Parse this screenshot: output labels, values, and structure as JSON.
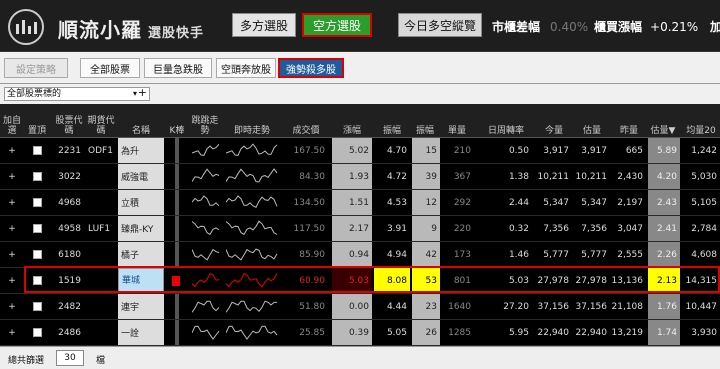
{
  "header": {
    "brand": "順流小羅",
    "subtitle": "選股快手",
    "buttons": [
      {
        "label": "多方選股",
        "active": false
      },
      {
        "label": "空方選股",
        "active": true
      }
    ],
    "overview_button": "今日多空縱覽",
    "metrics": [
      {
        "label": "市櫃差幅",
        "value": "0.40%",
        "dim": true
      },
      {
        "label": "櫃買漲幅",
        "value": "+0.21%",
        "dim": false
      }
    ],
    "metric_cut": "加"
  },
  "strategy_bar": {
    "set_strategy": "設定策略",
    "tabs": [
      {
        "label": "全部股票",
        "active": false
      },
      {
        "label": "巨量急跌股",
        "active": false
      },
      {
        "label": "空頭奔放股",
        "active": false
      },
      {
        "label": "強勢殺多股",
        "active": true
      }
    ]
  },
  "filter": {
    "selected": "全部股票標的",
    "arrow": "▾",
    "plus": "+"
  },
  "table": {
    "columns": [
      "加自選",
      "置頂",
      "股票代碼",
      "期貨代碼",
      "名稱",
      "K棒",
      "跳跳走勢",
      "即時走勢",
      "成交價",
      "漲幅",
      "振幅",
      "振幅",
      "單量",
      "日周轉率",
      "今量",
      "估量",
      "昨量",
      "估量▼",
      "均量20"
    ],
    "rows": [
      {
        "add": "+",
        "code": "2231",
        "fut": "ODF1",
        "name": "為升",
        "price": "167.50",
        "chg": "5.02",
        "amp": "4.70",
        "amp2": "15",
        "vol": "210",
        "turn": "0.50",
        "today": "3,917",
        "est": "3,917",
        "yest": "665",
        "ratio": "5.89",
        "avg": "1,242"
      },
      {
        "add": "+",
        "code": "3022",
        "fut": "",
        "name": "威強電",
        "price": "84.30",
        "chg": "1.93",
        "amp": "4.72",
        "amp2": "39",
        "vol": "367",
        "turn": "1.38",
        "today": "10,211",
        "est": "10,211",
        "yest": "2,430",
        "ratio": "4.20",
        "avg": "5,030"
      },
      {
        "add": "+",
        "code": "4968",
        "fut": "",
        "name": "立積",
        "price": "134.50",
        "chg": "1.51",
        "amp": "4.53",
        "amp2": "12",
        "vol": "292",
        "turn": "2.44",
        "today": "5,347",
        "est": "5,347",
        "yest": "2,197",
        "ratio": "2.43",
        "avg": "5,105"
      },
      {
        "add": "+",
        "code": "4958",
        "fut": "LUF1",
        "name": "臻鼎-KY",
        "price": "117.50",
        "chg": "2.17",
        "amp": "3.91",
        "amp2": "9",
        "vol": "220",
        "turn": "0.32",
        "today": "7,356",
        "est": "7,356",
        "yest": "3,047",
        "ratio": "2.41",
        "avg": "2,784"
      },
      {
        "add": "+",
        "code": "6180",
        "fut": "",
        "name": "橘子",
        "price": "85.90",
        "chg": "0.94",
        "amp": "4.94",
        "amp2": "42",
        "vol": "173",
        "turn": "1.46",
        "today": "5,777",
        "est": "5,777",
        "yest": "2,555",
        "ratio": "2.26",
        "avg": "4,608"
      },
      {
        "add": "+",
        "code": "1519",
        "fut": "",
        "name": "華城",
        "price": "60.90",
        "chg": "5.03",
        "amp": "8.08",
        "amp2": "53",
        "vol": "801",
        "turn": "5.03",
        "today": "27,978",
        "est": "27,978",
        "yest": "13,136",
        "ratio": "2.13",
        "avg": "14,315"
      },
      {
        "add": "+",
        "code": "2482",
        "fut": "",
        "name": "連宇",
        "price": "51.80",
        "chg": "0.00",
        "amp": "4.44",
        "amp2": "23",
        "vol": "1640",
        "turn": "27.20",
        "today": "37,156",
        "est": "37,156",
        "yest": "21,108",
        "ratio": "1.76",
        "avg": "10,447"
      },
      {
        "add": "+",
        "code": "2486",
        "fut": "",
        "name": "一詮",
        "price": "25.85",
        "chg": "0.39",
        "amp": "5.05",
        "amp2": "26",
        "vol": "1285",
        "turn": "5.95",
        "today": "22,940",
        "est": "22,940",
        "yest": "13,219",
        "ratio": "1.74",
        "avg": "3,930"
      }
    ]
  },
  "footer": {
    "label": "總共篩選",
    "count": "30",
    "unit": "檔"
  }
}
